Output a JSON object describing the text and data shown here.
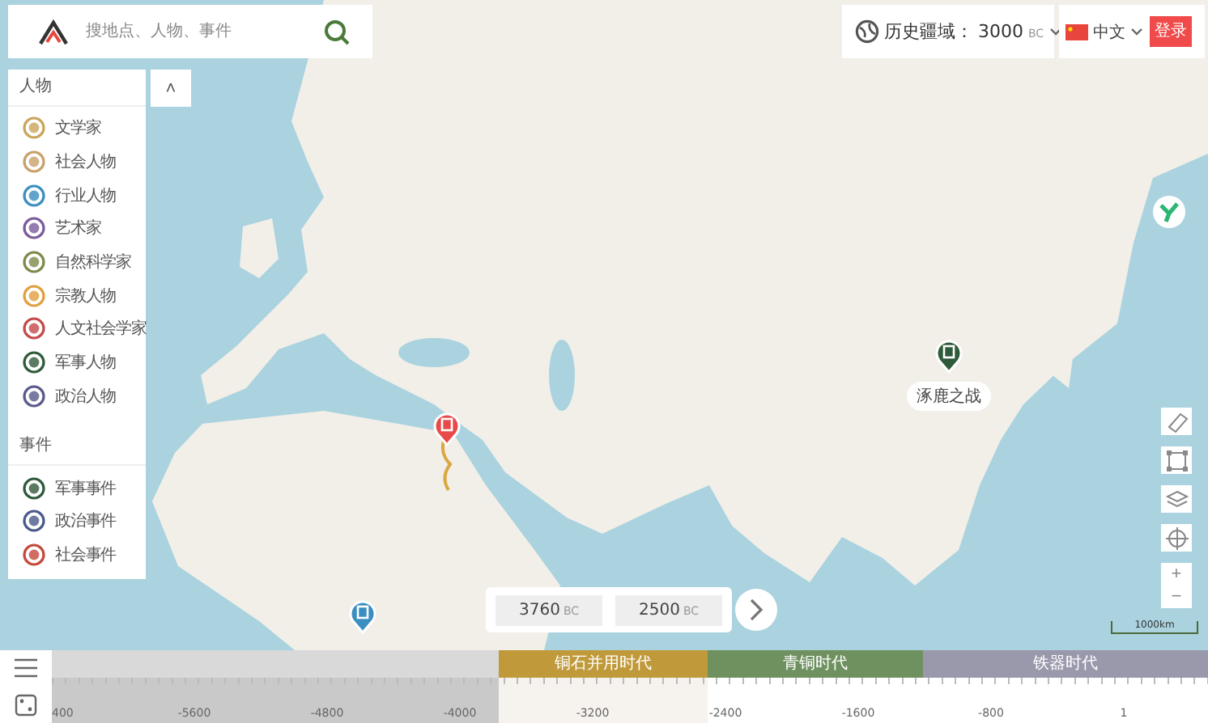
{
  "search": {
    "placeholder": "搜地点、人物、事件"
  },
  "territory": {
    "label": "历史疆域：",
    "year": "3000",
    "unit": "BC"
  },
  "language": {
    "label": "中文"
  },
  "login": {
    "label": "登录"
  },
  "sidebar": {
    "collapse_button": "˄",
    "groups": [
      {
        "title": "人物",
        "items": [
          {
            "label": "文学家",
            "color": "#c9a55a"
          },
          {
            "label": "社会人物",
            "color": "#c8a06a"
          },
          {
            "label": "行业人物",
            "color": "#3a8fc0"
          },
          {
            "label": "艺术家",
            "color": "#7a5b9a"
          },
          {
            "label": "自然科学家",
            "color": "#7c8a4a"
          },
          {
            "label": "宗教人物",
            "color": "#e0a040"
          },
          {
            "label": "人文社会学家",
            "color": "#c44a4a"
          },
          {
            "label": "军事人物",
            "color": "#2f5a3a"
          },
          {
            "label": "政治人物",
            "color": "#5a5a8a"
          }
        ]
      },
      {
        "title": "事件",
        "items": [
          {
            "label": "军事事件",
            "color": "#2f5a3a"
          },
          {
            "label": "政治事件",
            "color": "#4a5a8a"
          },
          {
            "label": "社会事件",
            "color": "#c44a3a"
          }
        ]
      }
    ]
  },
  "markers": [
    {
      "kind": "event",
      "color": "#e84a4a"
    },
    {
      "kind": "event",
      "color": "#2f5a3a",
      "label": "涿鹿之战"
    },
    {
      "kind": "event",
      "color": "#3a8fc0"
    }
  ],
  "map_controls": {
    "zoom_in": "+",
    "zoom_out": "−",
    "scale": "1000km"
  },
  "range": {
    "start": "3760",
    "start_unit": "BC",
    "end": "2500",
    "end_unit": "BC"
  },
  "timeline": {
    "eras": [
      {
        "label": "铜石并用时代",
        "color": "#c09a3a"
      },
      {
        "label": "青铜时代",
        "color": "#6f9160"
      },
      {
        "label": "铁器时代",
        "color": "#9a98ab"
      }
    ],
    "ticks": [
      "400",
      "-5600",
      "-4800",
      "-4000",
      "-3200",
      "-2400",
      "-1600",
      "-800",
      "1"
    ]
  }
}
